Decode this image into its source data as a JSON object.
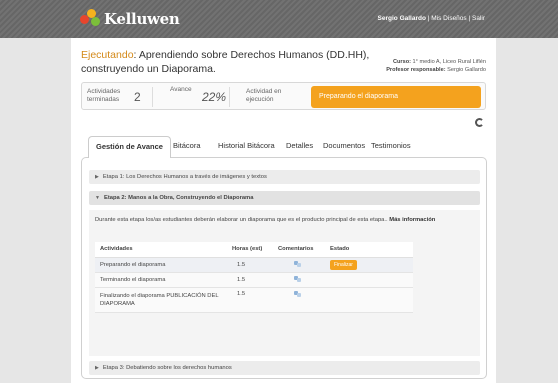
{
  "header": {
    "logo_text": "Kelluwen",
    "user_name": "Sergio Gallardo",
    "links": [
      "Mis Diseños",
      "Salir"
    ]
  },
  "design": {
    "status": "Ejecutando",
    "title_line1": "Aprendiendo sobre Derechos Humanos (DD.HH),",
    "title_line2": "construyendo un Diaporama.",
    "course_label": "Curso:",
    "course_value": "1° medio A, Liceo Rural Liflén",
    "teacher_label": "Profesor responsable:",
    "teacher_value": "Sergio Gallardo"
  },
  "stats": {
    "completed_label_1": "Actividades",
    "completed_label_2": "terminadas",
    "completed_value": "2",
    "progress_label": "Avance",
    "progress_value": "22%",
    "current_label_1": "Actividad en",
    "current_label_2": "ejecución",
    "current_value": "Preparando el diaporama"
  },
  "tabs": [
    "Gestión de Avance",
    "Bitácora",
    "Historial Bitácora",
    "Detalles",
    "Documentos",
    "Testimonios"
  ],
  "stages": {
    "stage1": "Etapa 1: Los Derechos Humanos a través de imágenes y textos",
    "stage2": "Etapa 2: Manos a la Obra, Construyendo el Diaporama",
    "stage3": "Etapa 3: Debatiendo sobre los derechos humanos"
  },
  "stage2_body": {
    "description": "Durante esta etapa los/as estudiantes deberán elaborar un diaporama que es el producto principal de esta etapa..",
    "more_info": "Más información",
    "columns": [
      "Actividades",
      "Horas (est)",
      "Comentarios",
      "Estado"
    ],
    "rows": [
      {
        "activity": "Preparando el diaporama",
        "hours": "1.5",
        "status_button": "Finalizar"
      },
      {
        "activity": "Terminando el diaporama",
        "hours": "1.5",
        "status_button": ""
      },
      {
        "activity": "Finalizando el diaporama PUBLICACIÓN DEL DIAPORAMA",
        "hours": "1.5",
        "status_button": ""
      }
    ]
  },
  "colors": {
    "accent": "#f4a21e",
    "topbar": "#6a6a6a"
  }
}
